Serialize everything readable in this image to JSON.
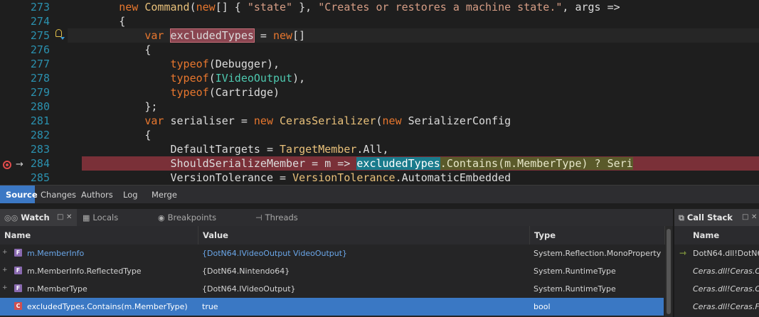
{
  "editor": {
    "lines": [
      {
        "num": "273",
        "tokens": [
          {
            "t": "        "
          },
          {
            "t": "new",
            "c": "kw"
          },
          {
            "t": " "
          },
          {
            "t": "Command",
            "c": "ty"
          },
          {
            "t": "("
          },
          {
            "t": "new",
            "c": "kw"
          },
          {
            "t": "[] { "
          },
          {
            "t": "\"state\"",
            "c": "st"
          },
          {
            "t": " }, "
          },
          {
            "t": "\"Creates or restores a machine state.\"",
            "c": "st"
          },
          {
            "t": ", args =>"
          }
        ]
      },
      {
        "num": "274",
        "tokens": [
          {
            "t": "        {"
          }
        ]
      },
      {
        "num": "275",
        "tokens": [
          {
            "t": "            "
          },
          {
            "t": "var",
            "c": "kw"
          },
          {
            "t": " "
          },
          {
            "t": "excludedTypes",
            "c": "hl-var"
          },
          {
            "t": " = "
          },
          {
            "t": "new",
            "c": "kw"
          },
          {
            "t": "[]"
          }
        ]
      },
      {
        "num": "276",
        "tokens": [
          {
            "t": "            {"
          }
        ]
      },
      {
        "num": "277",
        "tokens": [
          {
            "t": "                "
          },
          {
            "t": "typeof",
            "c": "kw"
          },
          {
            "t": "("
          },
          {
            "t": "Debugger",
            "c": "pl"
          },
          {
            "t": "),"
          }
        ]
      },
      {
        "num": "278",
        "tokens": [
          {
            "t": "                "
          },
          {
            "t": "typeof",
            "c": "kw"
          },
          {
            "t": "("
          },
          {
            "t": "IVideoOutput",
            "c": "if"
          },
          {
            "t": "),"
          }
        ]
      },
      {
        "num": "279",
        "tokens": [
          {
            "t": "                "
          },
          {
            "t": "typeof",
            "c": "kw"
          },
          {
            "t": "("
          },
          {
            "t": "Cartridge",
            "c": "pl"
          },
          {
            "t": ")"
          }
        ]
      },
      {
        "num": "280",
        "tokens": [
          {
            "t": "            };"
          }
        ]
      },
      {
        "num": "281",
        "tokens": [
          {
            "t": "            "
          },
          {
            "t": "var",
            "c": "kw"
          },
          {
            "t": " serialiser = "
          },
          {
            "t": "new",
            "c": "kw"
          },
          {
            "t": " "
          },
          {
            "t": "CerasSerializer",
            "c": "ty"
          },
          {
            "t": "("
          },
          {
            "t": "new",
            "c": "kw"
          },
          {
            "t": " SerializerConfig"
          }
        ]
      },
      {
        "num": "282",
        "tokens": [
          {
            "t": "            {"
          }
        ]
      },
      {
        "num": "283",
        "tokens": [
          {
            "t": "                DefaultTargets = "
          },
          {
            "t": "TargetMember",
            "c": "ty"
          },
          {
            "t": ".All,"
          }
        ]
      },
      {
        "num": "284",
        "tokens": [
          {
            "t": "                ShouldSerializeMember = m => "
          },
          {
            "t": "excludedTypes",
            "c": "hl-ref"
          },
          {
            "t": ".Contains(m.MemberType) ? Seri",
            "c": "hl-rest"
          }
        ]
      },
      {
        "num": "285",
        "tokens": [
          {
            "t": "                VersionTolerance = "
          },
          {
            "t": "VersionTolerance",
            "c": "ty"
          },
          {
            "t": ".AutomaticEmbedded"
          }
        ]
      }
    ]
  },
  "source_tabs": [
    "Source",
    "Changes",
    "Authors",
    "Log",
    "Merge"
  ],
  "watch_panel": {
    "tabs": [
      {
        "label": "Watch",
        "icon": "glasses-icon"
      },
      {
        "label": "Locals",
        "icon": "grid-icon"
      },
      {
        "label": "Breakpoints",
        "icon": "breakpoint-icon"
      },
      {
        "label": "Threads",
        "icon": "threads-icon"
      }
    ],
    "columns": [
      "Name",
      "Value",
      "Type"
    ],
    "rows": [
      {
        "name": "m.MemberInfo",
        "value": "{DotN64.IVideoOutput VideoOutput}",
        "type": "System.Reflection.MonoProperty",
        "icon": "F"
      },
      {
        "name": "m.MemberInfo.ReflectedType",
        "value": "{DotN64.Nintendo64}",
        "type": "System.RuntimeType",
        "icon": "F"
      },
      {
        "name": "m.MemberType",
        "value": "{DotN64.IVideoOutput}",
        "type": "System.RuntimeType",
        "icon": "F"
      },
      {
        "name": "excludedTypes.Contains(m.MemberType)",
        "value": "true",
        "type": "bool",
        "icon": "C"
      }
    ]
  },
  "call_stack": {
    "title": "Call Stack",
    "column": "Name",
    "rows": [
      "DotN64.dll!DotN6",
      "Ceras.dll!Ceras.C",
      "Ceras.dll!Ceras.C",
      "Ceras.dll!Ceras.F"
    ]
  }
}
